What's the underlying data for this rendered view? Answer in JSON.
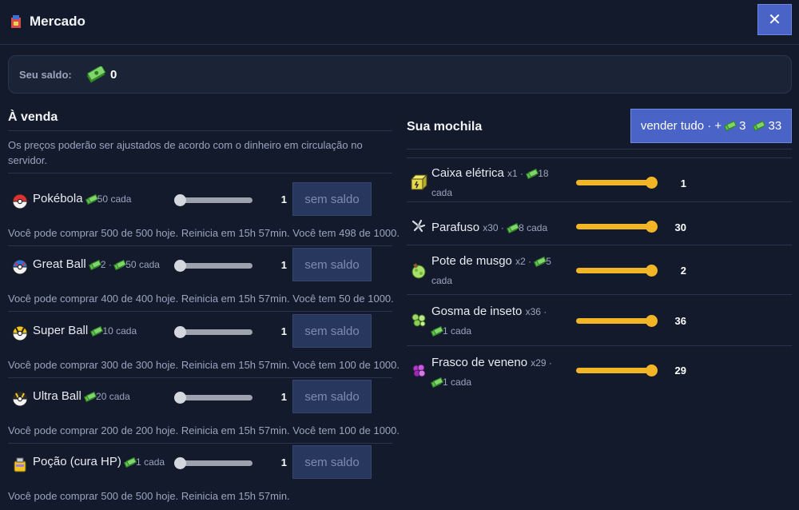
{
  "header": {
    "title": "Mercado",
    "close_label": "✕"
  },
  "balance": {
    "label": "Seu saldo:",
    "value": "0"
  },
  "shop": {
    "title": "À venda",
    "note": "Os preços poderão ser ajustados de acordo com o dinheiro em circulação no servidor.",
    "items": [
      {
        "name": "Pokébola",
        "price": "50",
        "unit": "cada",
        "qty": "1",
        "button": "sem saldo",
        "info": "Você pode comprar 500 de 500 hoje. Reinicia em 15h 57min. Você tem 498 de 1000."
      },
      {
        "name": "Great Ball",
        "price_prefix": "2",
        "price": "50",
        "unit": "cada",
        "qty": "1",
        "button": "sem saldo",
        "info": "Você pode comprar 400 de 400 hoje. Reinicia em 15h 57min. Você tem 50 de 1000."
      },
      {
        "name": "Super Ball",
        "price": "10",
        "unit": "cada",
        "qty": "1",
        "button": "sem saldo",
        "info": "Você pode comprar 300 de 300 hoje. Reinicia em 15h 57min. Você tem 100 de 1000."
      },
      {
        "name": "Ultra Ball",
        "price": "20",
        "unit": "cada",
        "qty": "1",
        "button": "sem saldo",
        "info": "Você pode comprar 200 de 200 hoje. Reinicia em 15h 57min. Você tem 100 de 1000."
      },
      {
        "name": "Poção (cura HP)",
        "price": "1",
        "unit": "cada",
        "qty": "1",
        "button": "sem saldo",
        "info": "Você pode comprar 500 de 500 hoje. Reinicia em 15h 57min."
      }
    ]
  },
  "bag": {
    "title": "Sua mochila",
    "sell_all": {
      "label": "vender tudo · +",
      "value_a": "3",
      "value_b": "33"
    },
    "items": [
      {
        "name": "Caixa elétrica",
        "count": "x1 ·",
        "price": "18",
        "unit": "cada",
        "qty": "1"
      },
      {
        "name": "Parafuso",
        "count": "x30 ·",
        "price": "8",
        "unit": "cada",
        "qty": "30"
      },
      {
        "name": "Pote de musgo",
        "count": "x2 ·",
        "price": "5",
        "unit": "cada",
        "qty": "2"
      },
      {
        "name": "Gosma de inseto",
        "count": "x36 ·",
        "price": "1",
        "unit": "cada",
        "qty": "36"
      },
      {
        "name": "Frasco de veneno",
        "count": "x29 ·",
        "price": "1",
        "unit": "cada",
        "qty": "29"
      }
    ]
  },
  "icons": {
    "logo": "shop-icon",
    "money": "money-icon",
    "pokeball": "pokeball-icon",
    "greatball": "great-ball-icon",
    "superball": "super-ball-icon",
    "ultraball": "ultra-ball-icon",
    "potion": "potion-icon",
    "electric_box": "electric-box-icon",
    "screw": "screw-icon",
    "moss": "moss-pot-icon",
    "slime": "bug-goo-icon",
    "poison": "poison-flask-icon"
  },
  "colors": {
    "accent": "#4a63c7",
    "background": "#121a2b",
    "slider_active": "#f2b526",
    "money_green": "#5ec34a"
  }
}
